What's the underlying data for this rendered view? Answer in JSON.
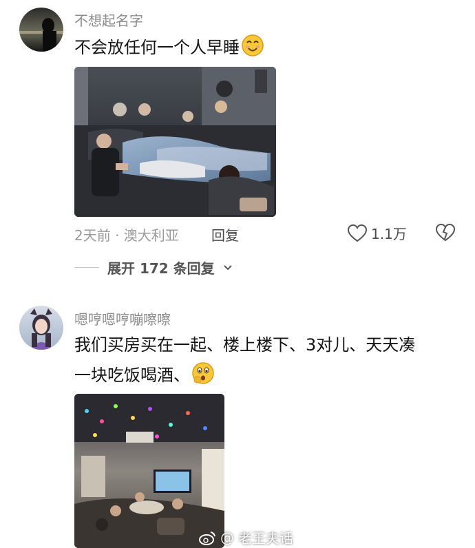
{
  "comments": [
    {
      "username": "不想起名字",
      "text": "不会放任何一个人早睡",
      "emoji": "smiling-face-emoji",
      "time_location": "2天前 · 澳大利亚",
      "reply_label": "回复",
      "likes": "1.1万",
      "expand_label": "展开 172 条回复",
      "photo": "group-on-couch-photo"
    },
    {
      "username": "嗯哼嗯哼嘣嚓嚓",
      "text_line1": "我们买房买在一起、楼上楼下、3对儿、天天凑",
      "text_line2": "一块吃饭喝酒、",
      "emoji": "shushing-face-emoji",
      "photo": "living-room-party-photo"
    }
  ],
  "watermark": {
    "prefix": "@",
    "name": "老王夫话"
  },
  "colors": {
    "username": "#8c8c8c",
    "text": "#141414",
    "meta": "#9a9a9a"
  }
}
